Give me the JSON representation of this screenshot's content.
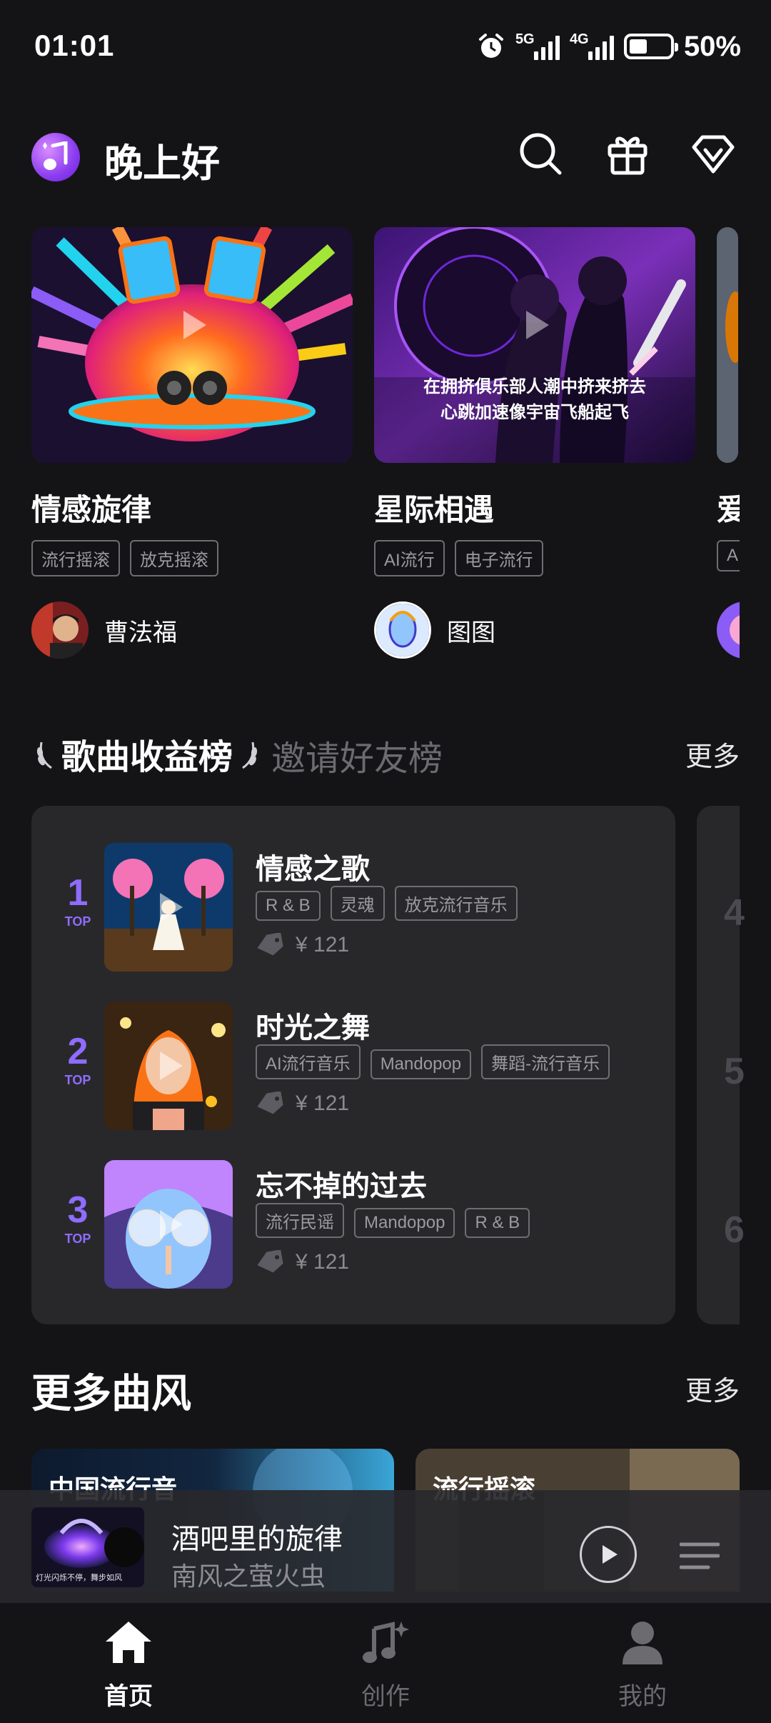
{
  "status": {
    "time": "01:01",
    "net1": "5G",
    "net2": "4G",
    "battery": "50%"
  },
  "header": {
    "greeting": "晚上好",
    "icons": [
      "search-icon",
      "gift-icon",
      "vip-diamond-icon"
    ]
  },
  "featured": [
    {
      "title": "情感旋律",
      "tags": [
        "流行摇滚",
        "放克摇滚"
      ],
      "author": "曹法福",
      "caption": ""
    },
    {
      "title": "星际相遇",
      "tags": [
        "AI流行",
        "电子流行"
      ],
      "author": "图图",
      "caption_line1": "在拥挤俱乐部人潮中挤来挤去",
      "caption_line2": "心跳加速像宇宙飞船起飞"
    },
    {
      "title": "爱",
      "tags": [
        "A"
      ],
      "author": ""
    }
  ],
  "ranking": {
    "tab_active": "歌曲收益榜",
    "tab_inactive": "邀请好友榜",
    "more": "更多",
    "top_label": "TOP",
    "items": [
      {
        "rank": "1",
        "title": "情感之歌",
        "tags": [
          "R & B",
          "灵魂",
          "放克流行音乐"
        ],
        "price": "¥ 121"
      },
      {
        "rank": "2",
        "title": "时光之舞",
        "tags": [
          "AI流行音乐",
          "Mandopop",
          "舞蹈-流行音乐"
        ],
        "price": "¥ 121"
      },
      {
        "rank": "3",
        "title": "忘不掉的过去",
        "tags": [
          "流行民谣",
          "Mandopop",
          "R & B"
        ],
        "price": "¥ 121"
      }
    ],
    "next_column_ranks": [
      "4",
      "5",
      "6"
    ]
  },
  "styles": {
    "title": "更多曲风",
    "more": "更多",
    "cards": [
      "中国流行音",
      "流行摇滚"
    ]
  },
  "player": {
    "title": "酒吧里的旋律",
    "artist": "南风之萤火虫",
    "cover_caption": "灯光闪烁不停，舞步如风"
  },
  "nav": {
    "home": "首页",
    "create": "创作",
    "mine": "我的"
  },
  "colors": {
    "background": "#141416",
    "panel": "#28282b",
    "accent_purple": "#8f6cff"
  }
}
